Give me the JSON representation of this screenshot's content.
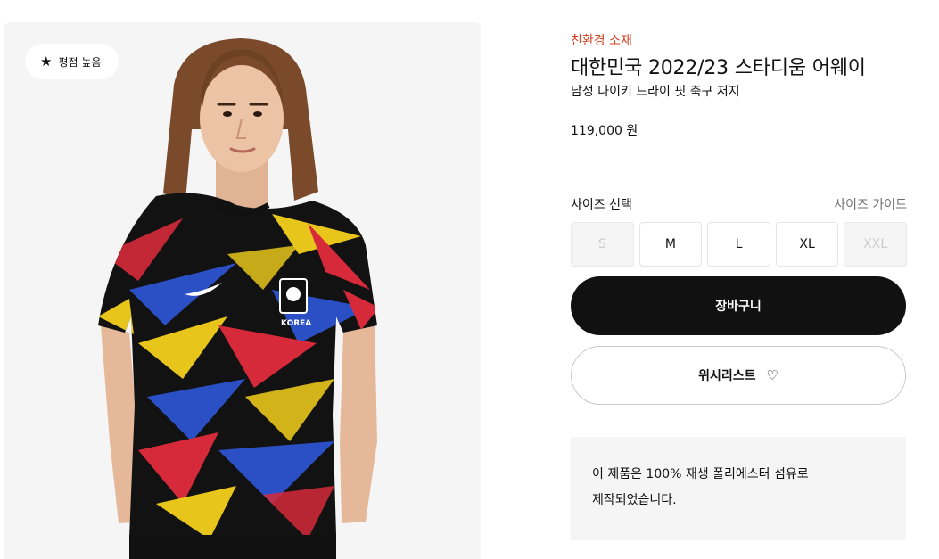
{
  "gallery": {
    "badge_label": "평점 높음",
    "badge_icon": "star-icon",
    "jersey_text": "KOREA"
  },
  "product": {
    "eco_tag": "친환경 소재",
    "title": "대한민국 2022/23 스타디움 어웨이",
    "subtitle": "남성 나이키 드라이 핏 축구 저지",
    "price": "119,000 원"
  },
  "sizes": {
    "label": "사이즈 선택",
    "guide_label": "사이즈 가이드",
    "options": [
      {
        "label": "S",
        "available": false
      },
      {
        "label": "M",
        "available": true
      },
      {
        "label": "L",
        "available": true
      },
      {
        "label": "XL",
        "available": true
      },
      {
        "label": "XXL",
        "available": false
      }
    ]
  },
  "actions": {
    "cart_label": "장바구니",
    "wishlist_label": "위시리스트",
    "wishlist_icon": "heart-icon"
  },
  "notice": {
    "line1": "이 제품은 100% 재생 폴리에스터 섬유로",
    "line2": "제작되었습니다."
  },
  "colors": {
    "accent": "#d43f21",
    "primary_button": "#111111",
    "panel_bg": "#f5f5f5"
  }
}
